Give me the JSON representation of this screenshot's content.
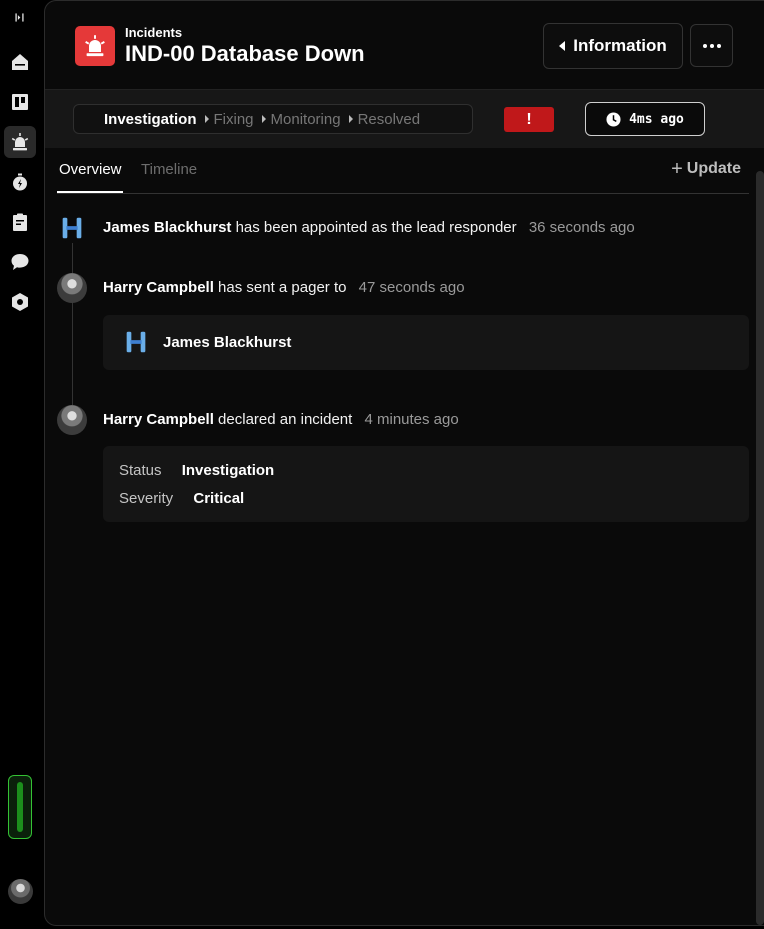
{
  "rail": {
    "items": [
      {
        "name": "home",
        "icon": "home-icon",
        "active": false
      },
      {
        "name": "board",
        "icon": "board-icon",
        "active": false
      },
      {
        "name": "incidents",
        "icon": "siren-icon",
        "active": true
      },
      {
        "name": "timer",
        "icon": "stopwatch-icon",
        "active": false
      },
      {
        "name": "clipboard",
        "icon": "clipboard-icon",
        "active": false
      },
      {
        "name": "chat",
        "icon": "chat-bubble-icon",
        "active": false
      },
      {
        "name": "settings",
        "icon": "hexagon-icon",
        "active": false
      }
    ],
    "status_color": "#34c234"
  },
  "header": {
    "breadcrumb": "Incidents",
    "title": "IND-00 Database Down",
    "info_button": "Information",
    "badge_color": "#e53939"
  },
  "status": {
    "steps": [
      "Investigation",
      "Fixing",
      "Monitoring",
      "Resolved"
    ],
    "current_step": "Investigation",
    "severity_symbol": "!",
    "severity_color": "#c0181a",
    "elapsed": "4ms ago"
  },
  "tabs": {
    "items": [
      "Overview",
      "Timeline"
    ],
    "active": "Overview",
    "update_label": "Update"
  },
  "events": [
    {
      "actor": "James Blackhurst",
      "action": "has been appointed as the lead responder",
      "time": "36 seconds ago",
      "avatar": "logo"
    },
    {
      "actor": "Harry Campbell",
      "action": "has sent a pager to",
      "time": "47 seconds ago",
      "avatar": "photo",
      "recipient": "James Blackhurst"
    },
    {
      "actor": "Harry Campbell",
      "action": "declared an incident",
      "time": "4 minutes ago",
      "avatar": "photo",
      "details": [
        {
          "label": "Status",
          "value": "Investigation"
        },
        {
          "label": "Severity",
          "value": "Critical"
        }
      ]
    }
  ]
}
